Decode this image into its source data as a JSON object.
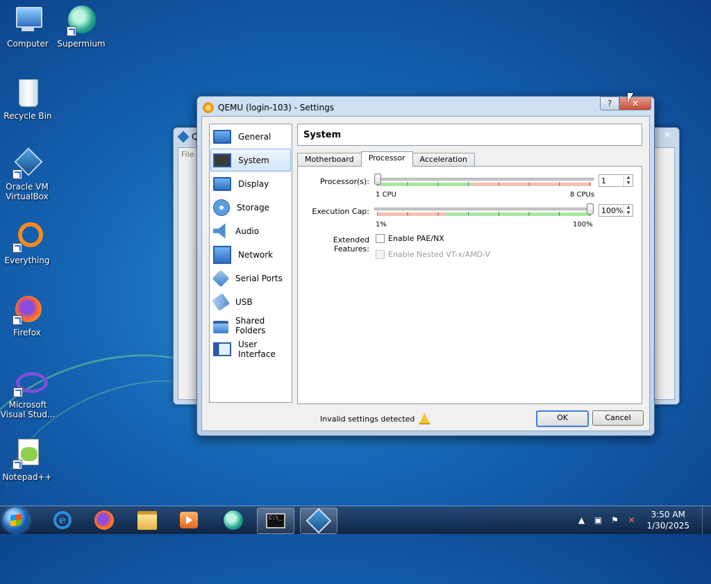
{
  "desktop": {
    "icons": [
      {
        "label": "Computer"
      },
      {
        "label": "Supermium"
      },
      {
        "label": "Recycle Bin"
      },
      {
        "label": "Oracle VM VirtualBox"
      },
      {
        "label": "Everything"
      },
      {
        "label": "Firefox"
      },
      {
        "label": "Microsoft Visual Stud..."
      },
      {
        "label": "Notepad++"
      }
    ]
  },
  "background_window": {
    "title_fragment": "Q",
    "menu_fragment": "File"
  },
  "dialog": {
    "title": "QEMU (login-103) - Settings",
    "help_label": "?",
    "close_label": "✕",
    "categories": [
      {
        "label": "General",
        "icon": "monitor-icon"
      },
      {
        "label": "System",
        "icon": "chip-icon",
        "selected": true
      },
      {
        "label": "Display",
        "icon": "display-icon"
      },
      {
        "label": "Storage",
        "icon": "disk-icon"
      },
      {
        "label": "Audio",
        "icon": "speaker-icon"
      },
      {
        "label": "Network",
        "icon": "network-icon"
      },
      {
        "label": "Serial Ports",
        "icon": "serial-port-icon"
      },
      {
        "label": "USB",
        "icon": "usb-icon"
      },
      {
        "label": "Shared Folders",
        "icon": "folder-icon"
      },
      {
        "label": "User Interface",
        "icon": "window-icon"
      }
    ],
    "page_title": "System",
    "tabs": [
      {
        "label": "Motherboard"
      },
      {
        "label": "Processor",
        "active": true
      },
      {
        "label": "Acceleration"
      }
    ],
    "processor": {
      "processors_label": "Processor(s):",
      "processors_value": "1",
      "processors_min_label": "1 CPU",
      "processors_max_label": "8 CPUs",
      "processors_level": 0.0,
      "cap_label": "Execution Cap:",
      "cap_value": "100%",
      "cap_min_label": "1%",
      "cap_max_label": "100%",
      "cap_level": 1.0,
      "features_label": "Extended Features:",
      "pae_label": "Enable PAE/NX",
      "pae_checked": false,
      "nested_label": "Enable Nested VT-x/AMD-V",
      "nested_enabled": false
    },
    "status_text": "Invalid settings detected",
    "ok_label": "OK",
    "cancel_label": "Cancel"
  },
  "taskbar": {
    "pinned": [
      "internet-explorer-icon",
      "firefox-icon",
      "file-explorer-icon",
      "media-player-icon",
      "supermium-icon",
      "command-prompt-icon",
      "virtualbox-icon"
    ],
    "time": "3:50 AM",
    "date": "1/30/2025"
  },
  "colors": {
    "accent": "#3c7fd4",
    "slider_green": "#a8e6a0",
    "slider_red": "#f3c0b4"
  }
}
